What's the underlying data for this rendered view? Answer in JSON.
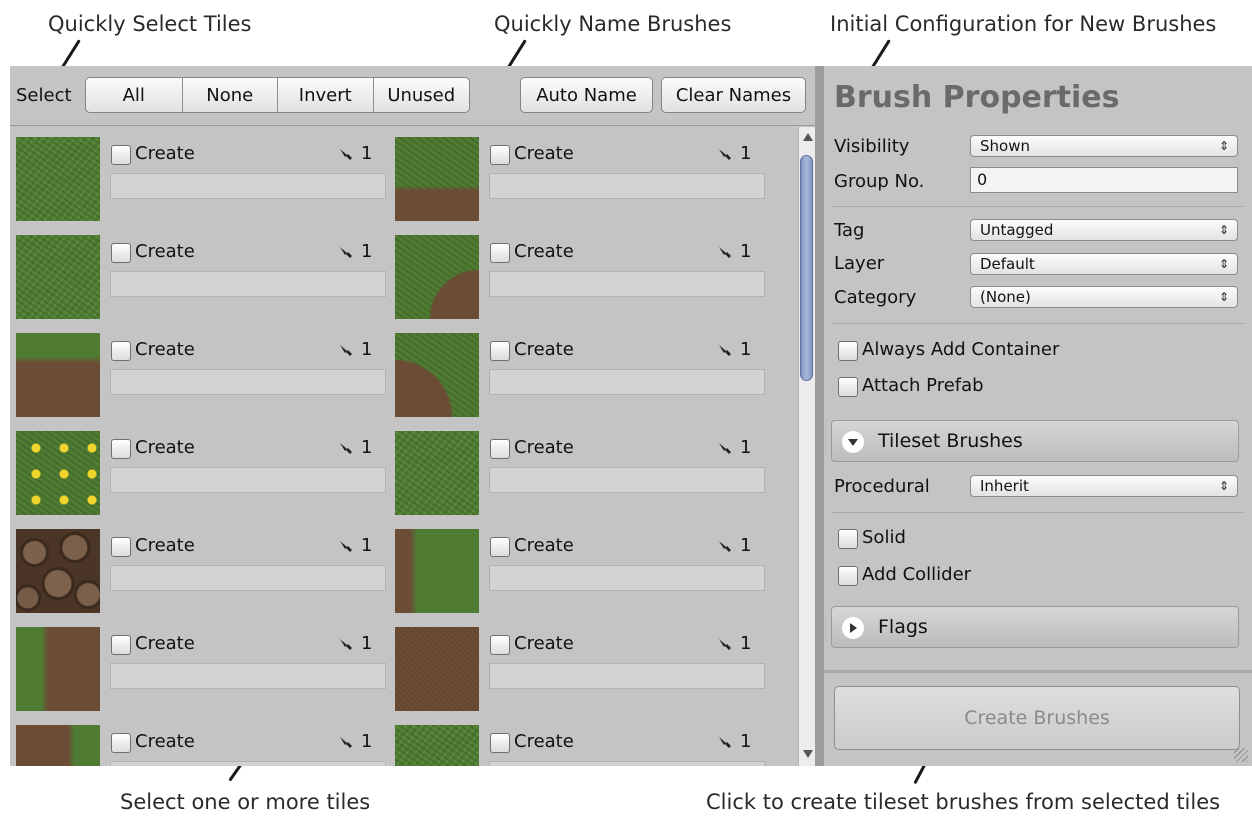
{
  "callouts": {
    "select_tiles": "Quickly Select Tiles",
    "name_brushes": "Quickly Name Brushes",
    "initial_config": "Initial Configuration for New Brushes",
    "select_one_or_more": "Select one or more tiles",
    "click_to_create": "Click to create tileset brushes from selected tiles"
  },
  "toolbar": {
    "select_label": "Select",
    "all": "All",
    "none": "None",
    "invert": "Invert",
    "unused": "Unused",
    "auto_name": "Auto Name",
    "clear_names": "Clear Names"
  },
  "tiles": [
    {
      "create_label": "Create",
      "count": "1",
      "texture": "grass"
    },
    {
      "create_label": "Create",
      "count": "1",
      "texture": "edge-bottom-dirt"
    },
    {
      "create_label": "Create",
      "count": "1",
      "texture": "grass"
    },
    {
      "create_label": "Create",
      "count": "1",
      "texture": "corner-dirt"
    },
    {
      "create_label": "Create",
      "count": "1",
      "texture": "edge-top-dirt"
    },
    {
      "create_label": "Create",
      "count": "1",
      "texture": "corner2-dirt"
    },
    {
      "create_label": "Create",
      "count": "1",
      "texture": "flowers"
    },
    {
      "create_label": "Create",
      "count": "1",
      "texture": "grass"
    },
    {
      "create_label": "Create",
      "count": "1",
      "texture": "stone"
    },
    {
      "create_label": "Create",
      "count": "1",
      "texture": "left-dirt"
    },
    {
      "create_label": "Create",
      "count": "1",
      "texture": "side-dirt"
    },
    {
      "create_label": "Create",
      "count": "1",
      "texture": "dirt"
    },
    {
      "create_label": "Create",
      "count": "1",
      "texture": "side-r-dirt"
    },
    {
      "create_label": "Create",
      "count": "1",
      "texture": "grass"
    }
  ],
  "brush_properties": {
    "title": "Brush Properties",
    "visibility_label": "Visibility",
    "visibility_value": "Shown",
    "group_label": "Group No.",
    "group_value": "0",
    "tag_label": "Tag",
    "tag_value": "Untagged",
    "layer_label": "Layer",
    "layer_value": "Default",
    "category_label": "Category",
    "category_value": "(None)",
    "always_add_container": "Always Add Container",
    "attach_prefab": "Attach Prefab",
    "tileset_brushes": "Tileset Brushes",
    "procedural_label": "Procedural",
    "procedural_value": "Inherit",
    "solid": "Solid",
    "add_collider": "Add Collider",
    "flags": "Flags",
    "create_brushes": "Create Brushes"
  },
  "icons": {
    "dropdown_arrow": "⇕",
    "count_icon": "paint-brush-icon"
  }
}
